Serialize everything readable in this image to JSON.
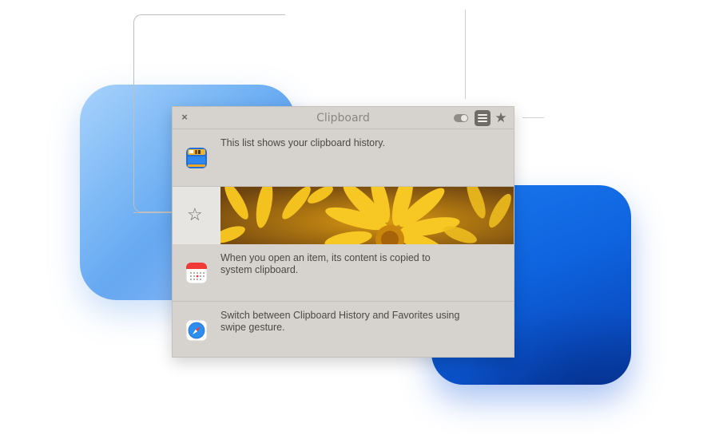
{
  "window": {
    "title": "Clipboard",
    "close_glyph": "×",
    "star_glyph": "★"
  },
  "items": [
    {
      "icon": "archive-app-icon",
      "text": "This list shows your clipboard history."
    },
    {
      "icon": "flower-image",
      "remove_glyph": "✕",
      "favorite_glyph": "☆"
    },
    {
      "icon": "calendar-app-icon",
      "text": "When you open an item, its content is copied to system clipboard."
    },
    {
      "icon": "safari-compass-icon",
      "text": "Switch between Clipboard History and Favorites using swipe gesture."
    }
  ],
  "colors": {
    "window_bg": "#d6d3ce",
    "accent_blue": "#0e63de",
    "light_blue": "#7ab7f5"
  }
}
